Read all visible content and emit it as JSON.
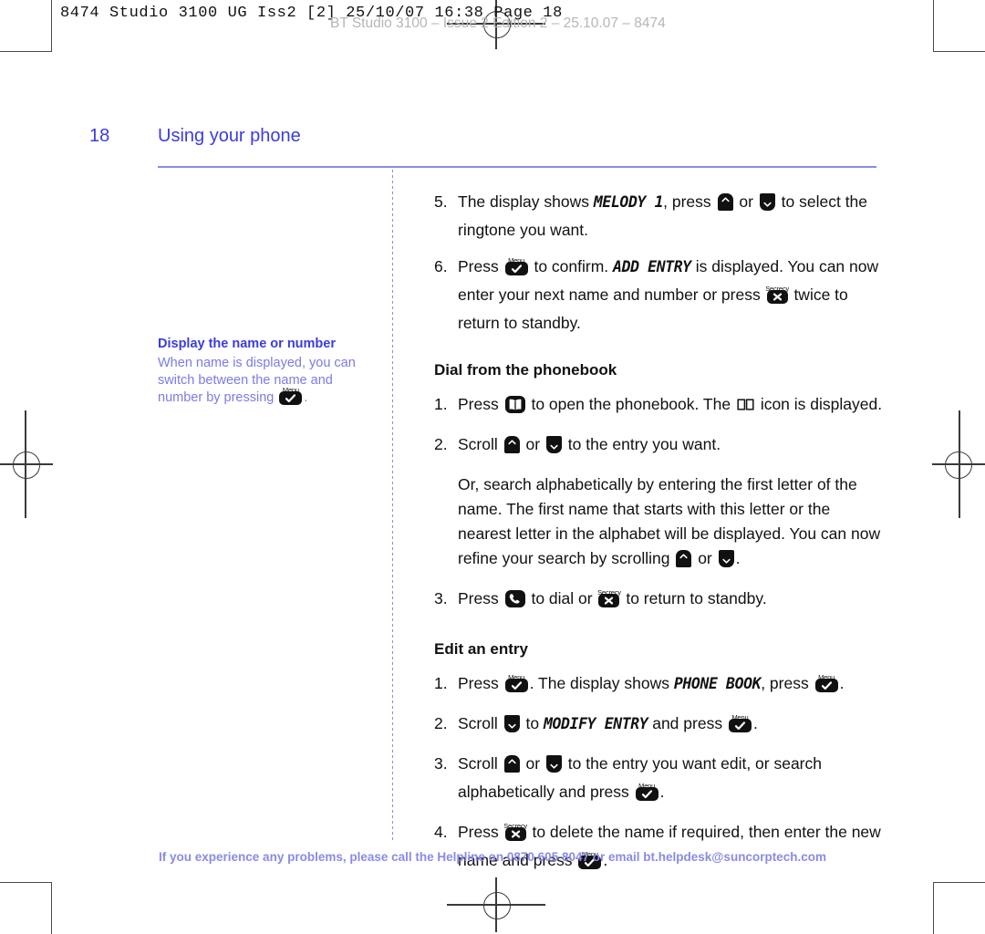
{
  "print_marks": {
    "slug_text": "8474 Studio 3100 UG Iss2 [2]  25/10/07  16:38  Page 18",
    "ghost_text": "BT Studio 3100 – Issue 2  Edition 2 – 25.10.07 – 8474"
  },
  "header": {
    "page_number": "18",
    "title": "Using your phone"
  },
  "sidebar_note": {
    "title": "Display the name or number",
    "body_before": "When name is displayed, you can switch between the name and number by pressing ",
    "body_after": "."
  },
  "keys": {
    "menu_label": "Menu",
    "menu_glyph": "✓",
    "secrecy_label": "Secrecy",
    "secrecy_glyph": "✗",
    "phonebook_name": "phonebook-key",
    "dial_name": "dial-key",
    "up_glyph": "︿",
    "down_glyph": "﹀"
  },
  "main": {
    "steps_continued": [
      {
        "num": "5.",
        "t1": "The display shows ",
        "lcd1": "MELODY 1",
        "t2": ", press ",
        "t3": " or ",
        "t4": " to select the ringtone you want."
      },
      {
        "num": "6.",
        "t1": "Press ",
        "t2": " to confirm. ",
        "lcd1": "ADD ENTRY",
        "t3": " is displayed. You can now enter your next name and number or press ",
        "t4": " twice to return to standby."
      }
    ],
    "section_dial": {
      "heading": "Dial from the phonebook",
      "steps": [
        {
          "num": "1.",
          "t1": "Press ",
          "t2": " to open the phonebook. The ",
          "t3": " icon is displayed."
        },
        {
          "num": "2.",
          "t1": "Scroll ",
          "t2": " or ",
          "t3": " to the entry you want."
        }
      ],
      "paragraph": {
        "t1": "Or, search alphabetically by entering the first letter of the name. The first name that starts with this letter or the nearest letter in the alphabet will be displayed. You can now refine your search by scrolling ",
        "t2": " or ",
        "t3": "."
      },
      "step3": {
        "num": "3.",
        "t1": "Press ",
        "t2": " to dial or ",
        "t3": " to return to standby."
      }
    },
    "section_edit": {
      "heading": "Edit an entry",
      "steps": [
        {
          "num": "1.",
          "t1": "Press ",
          "t2": ". The display shows ",
          "lcd1": "PHONE BOOK",
          "t3": ", press ",
          "t4": "."
        },
        {
          "num": "2.",
          "t1": "Scroll ",
          "t2": " to ",
          "lcd1": "MODIFY ENTRY",
          "t3": " and press ",
          "t4": "."
        },
        {
          "num": "3.",
          "t1": "Scroll ",
          "t2": " or ",
          "t3": " to the entry you want edit, or search alphabetically and press ",
          "t4": "."
        },
        {
          "num": "4.",
          "t1": "Press ",
          "t2": " to delete the name if required, then enter the new name and press ",
          "t3": "."
        }
      ]
    }
  },
  "footer": {
    "helpline": "If you experience any problems, please call the Helpline on 0870 605 8047 or email bt.helpdesk@suncorptech.com"
  },
  "colors": {
    "brand_blue": "#3b3be0",
    "light_blue": "#8a8ae8",
    "note_body": "#7b7be6",
    "body_text": "#111111"
  }
}
